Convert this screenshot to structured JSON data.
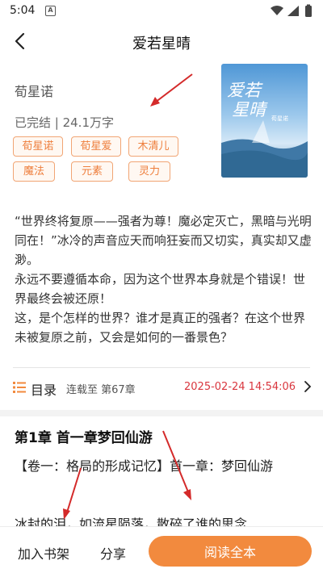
{
  "status_bar": {
    "time": "5:04",
    "notification_badge": "A",
    "icons": [
      "wifi-icon",
      "signal-icon",
      "battery-icon"
    ]
  },
  "header": {
    "title": "爱若星晴",
    "back_icon": "back-arrow-icon"
  },
  "book": {
    "author": "荀星诺",
    "meta": "已完结 | 24.1万字",
    "tags": [
      "荀星诺",
      "荀星爱",
      "木清儿",
      "魔法",
      "元素",
      "灵力"
    ],
    "cover": {
      "title": "爱若星晴",
      "author_text": "荀星诺"
    }
  },
  "intro": {
    "paragraphs": [
      "“世界终将复原——强者为尊！魔必定灭亡，黑暗与光明同在！”冰冷的声音应天而响狂妄而又切实，真实却又虚渺。",
      "永远不要遵循本命，因为这个世界本身就是个错误！世界最终会被还原！",
      "这，是个怎样的世界？谁才是真正的强者？在这个世界未被复原之前，又会是如何的一番景色？"
    ]
  },
  "toc": {
    "label": "目录",
    "serial": "连载至 第67章",
    "updated": "2025-02-24 14:54:06"
  },
  "chapter": {
    "title": "第1章 首一章梦回仙游",
    "text": "【卷一：格局的形成记忆】首一章：梦回仙游",
    "cut_line": "冰封的泪，如流星陨落，散碎了谁的思念"
  },
  "bottom_bar": {
    "add_shelf": "加入书架",
    "share": "分享",
    "read_all": "阅读全本"
  },
  "colors": {
    "accent": "#f28a3e",
    "tag_text": "#ee7e3c",
    "date": "#d9363e",
    "annotation_arrow": "#d42a2a"
  }
}
